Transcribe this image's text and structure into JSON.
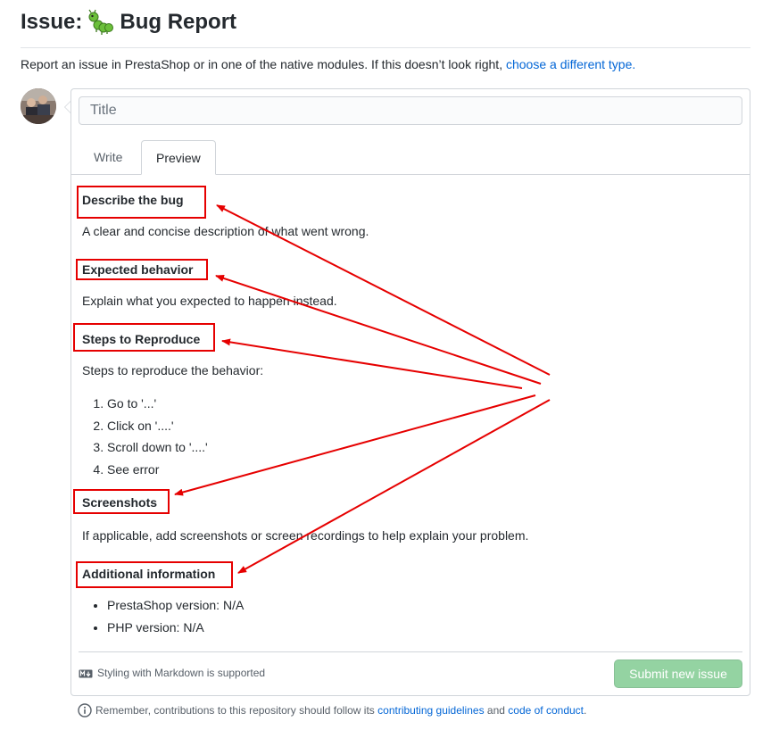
{
  "header": {
    "prefix": "Issue:",
    "bug_emoji": "🐛",
    "title": "Bug Report"
  },
  "intro": {
    "text": "Report an issue in PrestaShop or in one of the native modules. If this doesn’t look right, ",
    "link": "choose a different type."
  },
  "form": {
    "title_placeholder": "Title",
    "tabs": [
      {
        "label": "Write"
      },
      {
        "label": "Preview"
      }
    ],
    "active_tab": "Preview"
  },
  "preview": {
    "describe_heading": "Describe the bug",
    "describe_text": "A clear and concise description of what went wrong.",
    "expected_heading": "Expected behavior",
    "expected_text": "Explain what you expected to happen instead.",
    "steps_heading": "Steps to Reproduce",
    "steps_text": "Steps to reproduce the behavior:",
    "steps": [
      "Go to '...'",
      "Click on '....'",
      "Scroll down to '....'",
      "See error"
    ],
    "screenshots_heading": "Screenshots",
    "screenshots_text": "If applicable, add screenshots or screen recordings to help explain your problem.",
    "additional_heading": "Additional information",
    "additional_items": [
      "PrestaShop version: N/A",
      "PHP version: N/A"
    ]
  },
  "footer": {
    "markdown_note": "Styling with Markdown is supported",
    "submit_label": "Submit new issue",
    "remember_text": "Remember, contributions to this repository should follow its ",
    "guidelines_link": "contributing guidelines",
    "and_text": " and ",
    "conduct_link": "code of conduct",
    "end_text": "."
  },
  "colors": {
    "link": "#0366d6",
    "annotation": "#e60000",
    "submit_disabled": "#94d3a2"
  }
}
